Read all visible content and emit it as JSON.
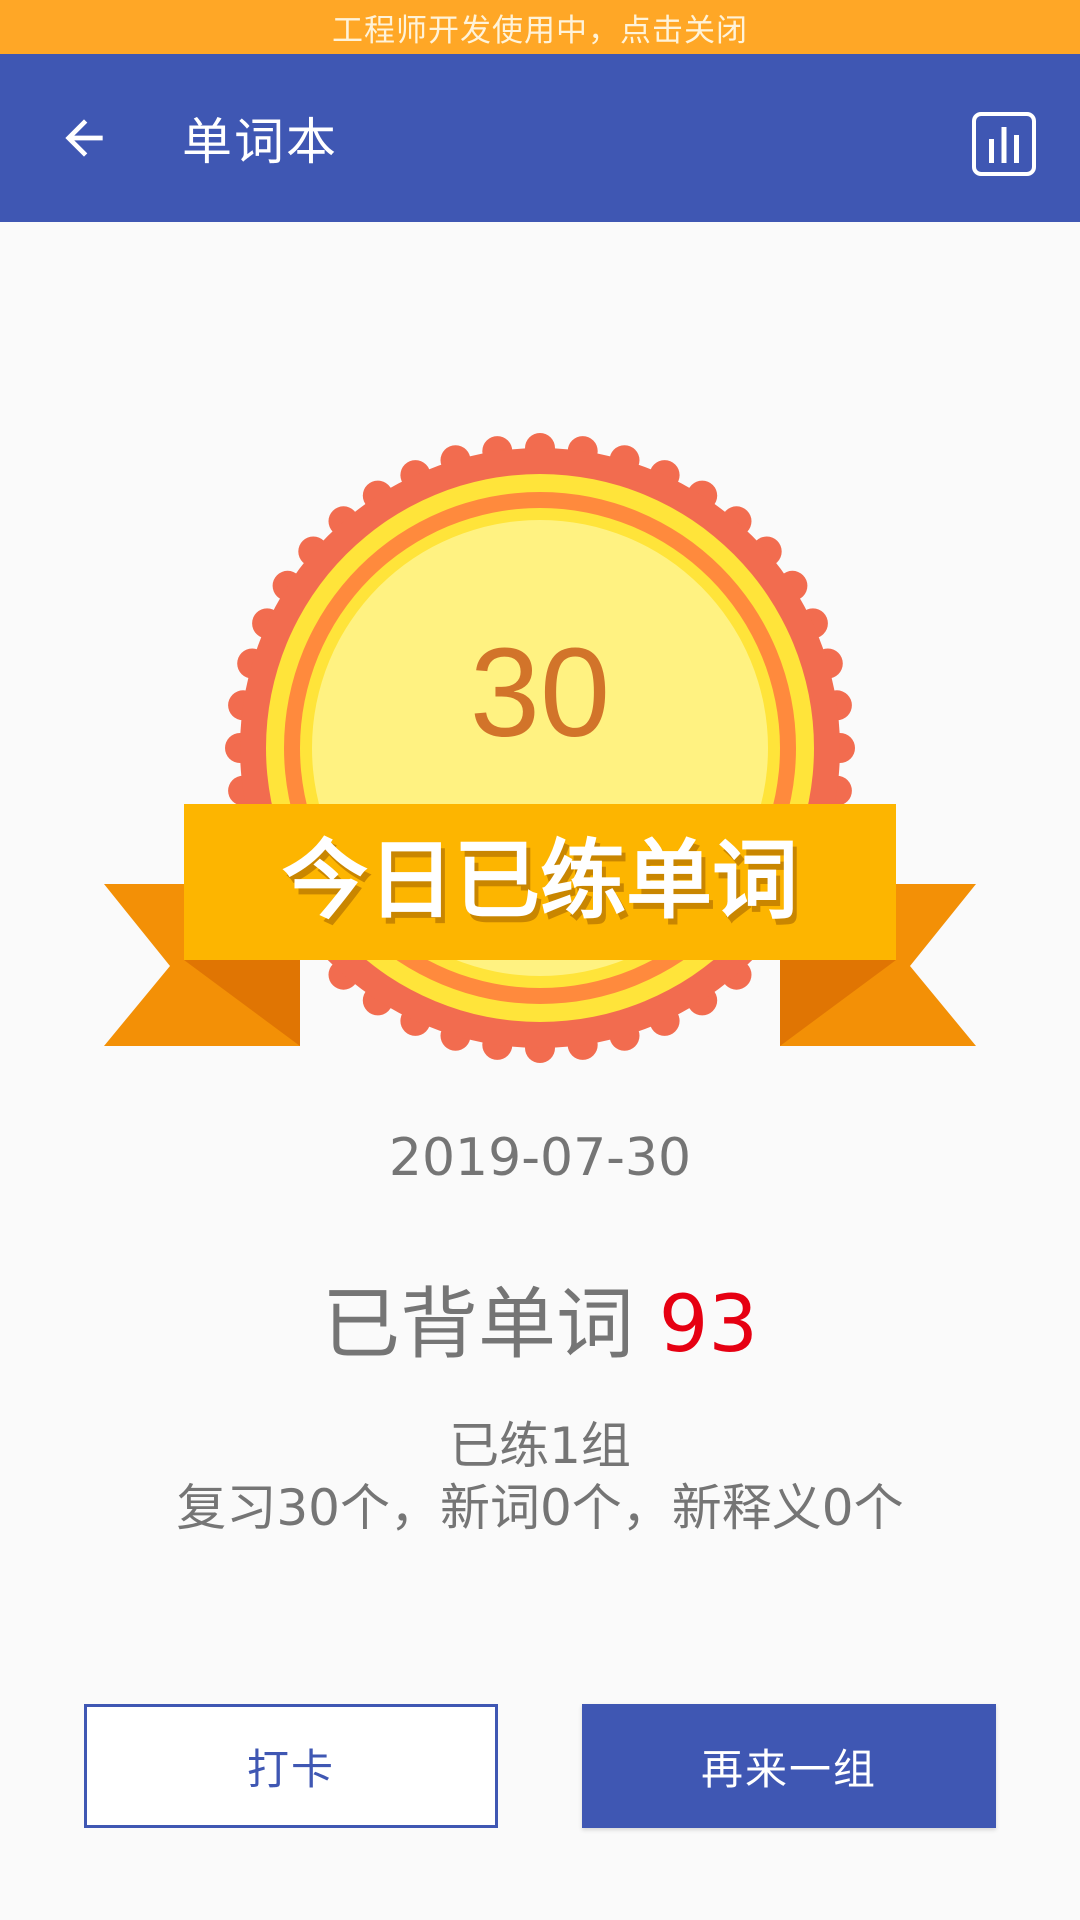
{
  "dev_banner": {
    "text": "工程师开发使用中，点击关闭"
  },
  "appbar": {
    "title": "单词本",
    "back_icon": "arrow-back-icon",
    "stats_icon": "bar-chart-icon"
  },
  "badge": {
    "count": "30",
    "ribbon_text": "今日已练单词"
  },
  "summary": {
    "date": "2019-07-30",
    "learned_label": "已背单词 ",
    "learned_count": "93",
    "groups_text": "已练1组",
    "detail_text": "复习30个，新词0个，新释义0个"
  },
  "buttons": {
    "checkin_label": "打卡",
    "again_label": "再来一组"
  },
  "colors": {
    "primary": "#3f57b3",
    "banner": "#ffa726",
    "highlight": "#e60012",
    "text_gray": "#757575"
  }
}
